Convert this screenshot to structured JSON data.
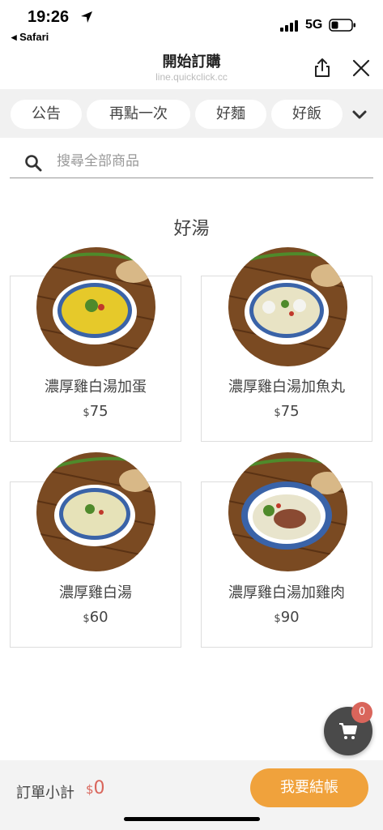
{
  "status_bar": {
    "time": "19:26",
    "back_app": "◂ Safari",
    "network": "5G",
    "icons": [
      "location-arrow-icon",
      "signal-bars-icon",
      "battery-icon"
    ]
  },
  "header": {
    "title": "開始訂購",
    "url": "line.quickclick.cc",
    "icons": [
      "share-icon",
      "close-icon"
    ]
  },
  "categories": {
    "items": [
      {
        "label": "公告"
      },
      {
        "label": "再點一次"
      },
      {
        "label": "好麵"
      },
      {
        "label": "好飯"
      }
    ],
    "expand_icon": "chevron-down-icon"
  },
  "search": {
    "placeholder": "搜尋全部商品",
    "value": "",
    "icon": "search-icon"
  },
  "section": {
    "title": "好湯"
  },
  "products": [
    {
      "name": "濃厚雞白湯加蛋",
      "currency": "$",
      "price": "75"
    },
    {
      "name": "濃厚雞白湯加魚丸",
      "currency": "$",
      "price": "75"
    },
    {
      "name": "濃厚雞白湯",
      "currency": "$",
      "price": "60"
    },
    {
      "name": "濃厚雞白湯加雞肉",
      "currency": "$",
      "price": "90"
    }
  ],
  "cart": {
    "count": "0",
    "icon": "cart-icon"
  },
  "footer": {
    "subtotal_label": "訂單小計",
    "currency": "$",
    "subtotal_value": "0",
    "checkout_label": "我要結帳"
  },
  "colors": {
    "accent_orange": "#f0a23c",
    "price_red": "#d9655b",
    "category_bar_bg": "#f1f1f1",
    "fab_bg": "#4a4a4a"
  }
}
